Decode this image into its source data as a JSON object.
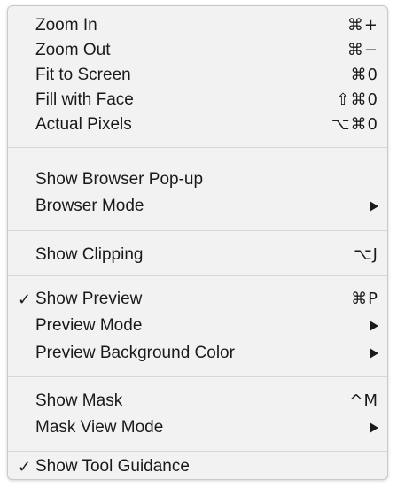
{
  "menu": {
    "items": [
      {
        "label": "Zoom In",
        "shortcut": "⌘+",
        "checked": "",
        "submenu": false
      },
      {
        "label": "Zoom Out",
        "shortcut": "⌘−",
        "checked": "",
        "submenu": false
      },
      {
        "label": "Fit to Screen",
        "shortcut": "⌘0",
        "checked": "",
        "submenu": false
      },
      {
        "label": "Fill with Face",
        "shortcut": "⇧⌘0",
        "checked": "",
        "submenu": false
      },
      {
        "label": "Actual Pixels",
        "shortcut": "⌥⌘0",
        "checked": "",
        "submenu": false
      },
      {
        "label": "Show Browser Pop-up",
        "shortcut": "",
        "checked": "",
        "submenu": false
      },
      {
        "label": "Browser Mode",
        "shortcut": "",
        "checked": "",
        "submenu": true
      },
      {
        "label": "Show Clipping",
        "shortcut": "⌥J",
        "checked": "",
        "submenu": false
      },
      {
        "label": "Show Preview",
        "shortcut": "⌘P",
        "checked": "✓",
        "submenu": false
      },
      {
        "label": "Preview Mode",
        "shortcut": "",
        "checked": "",
        "submenu": true
      },
      {
        "label": "Preview Background Color",
        "shortcut": "",
        "checked": "",
        "submenu": true
      },
      {
        "label": "Show Mask",
        "shortcut": "^M",
        "checked": "",
        "submenu": false
      },
      {
        "label": "Mask View Mode",
        "shortcut": "",
        "checked": "",
        "submenu": true
      },
      {
        "label": "Show Tool Guidance",
        "shortcut": "",
        "checked": "✓",
        "submenu": false
      }
    ]
  }
}
